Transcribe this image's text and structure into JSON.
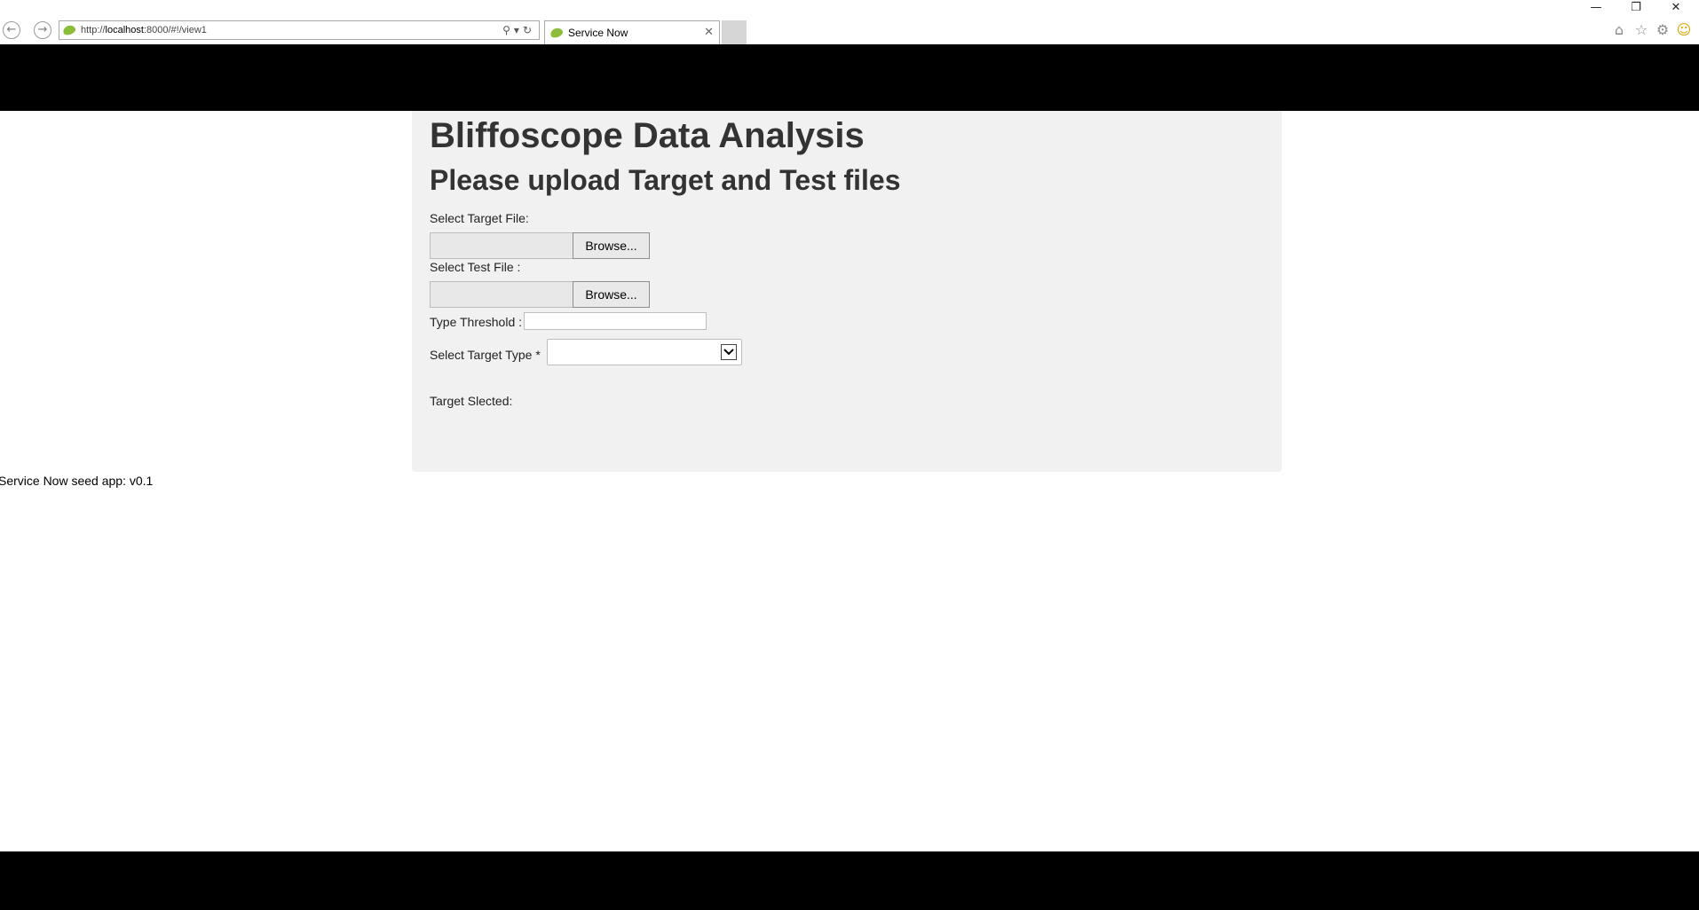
{
  "browser": {
    "url_prefix": "http://",
    "url_host": "localhost",
    "url_rest": ":8000/#!/view1",
    "tab_title": "Service Now",
    "back_icon": "back-arrow-icon",
    "forward_icon": "forward-arrow-icon",
    "window_controls": [
      "minimize-icon",
      "restore-icon",
      "close-icon"
    ],
    "toolbar_icons": [
      "home-icon",
      "favorites-star-icon",
      "settings-gear-icon",
      "feedback-smiley-icon"
    ]
  },
  "page": {
    "title": "Bliffoscope Data Analysis",
    "subtitle": "Please upload Target and Test files",
    "target_file_label": "Select Target File:",
    "test_file_label": "Select Test File :",
    "browse_label": "Browse...",
    "threshold_label": "Type Threshold :",
    "threshold_value": "",
    "target_type_label": "Select Target Type *",
    "target_type_selected": "",
    "target_selected_label": "Target Slected:",
    "footer_version": "Service Now seed app: v0.1"
  },
  "colors": {
    "header_bar": "#000000",
    "footer_bar": "#000000",
    "panel_background": "#f1f1f1",
    "heading_text": "#333333"
  }
}
